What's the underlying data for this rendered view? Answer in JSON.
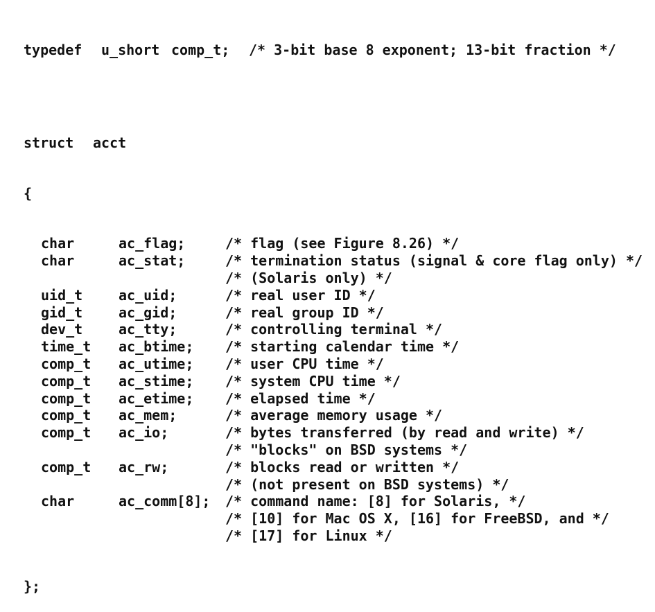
{
  "typedef": {
    "keyword": "typedef",
    "type": "u_short",
    "name": "comp_t;",
    "comment": "/* 3-bit base 8 exponent; 13-bit fraction */"
  },
  "struct_header": {
    "keyword": "struct",
    "name": "acct",
    "open_brace": "{",
    "close_brace": "};"
  },
  "fields": [
    {
      "type": "char",
      "name": "ac_flag;",
      "comment": "/* flag (see Figure 8.26) */"
    },
    {
      "type": "char",
      "name": "ac_stat;",
      "comment": "/* termination status (signal & core flag only) */"
    },
    {
      "type": "",
      "name": "",
      "comment": "/* (Solaris only) */"
    },
    {
      "type": "uid_t",
      "name": "ac_uid;",
      "comment": "/* real user ID */"
    },
    {
      "type": "gid_t",
      "name": "ac_gid;",
      "comment": "/* real group ID */"
    },
    {
      "type": "dev_t",
      "name": "ac_tty;",
      "comment": "/* controlling terminal */"
    },
    {
      "type": "time_t",
      "name": "ac_btime;",
      "comment": "/* starting calendar time */"
    },
    {
      "type": "comp_t",
      "name": "ac_utime;",
      "comment": "/* user CPU time */"
    },
    {
      "type": "comp_t",
      "name": "ac_stime;",
      "comment": "/* system CPU time */"
    },
    {
      "type": "comp_t",
      "name": "ac_etime;",
      "comment": "/* elapsed time */"
    },
    {
      "type": "comp_t",
      "name": "ac_mem;",
      "comment": "/* average memory usage */"
    },
    {
      "type": "comp_t",
      "name": "ac_io;",
      "comment": "/* bytes transferred (by read and write) */"
    },
    {
      "type": "",
      "name": "",
      "comment": "/* \"blocks\" on BSD systems */"
    },
    {
      "type": "comp_t",
      "name": "ac_rw;",
      "comment": "/* blocks read or written */"
    },
    {
      "type": "",
      "name": "",
      "comment": "/* (not present on BSD systems) */"
    },
    {
      "type": "char",
      "name": "ac_comm[8];",
      "comment": "/* command name: [8] for Solaris, */"
    },
    {
      "type": "",
      "name": "",
      "comment": "/* [10] for Mac OS X, [16] for FreeBSD, and */"
    },
    {
      "type": "",
      "name": "",
      "comment": "/* [17] for Linux */"
    }
  ]
}
